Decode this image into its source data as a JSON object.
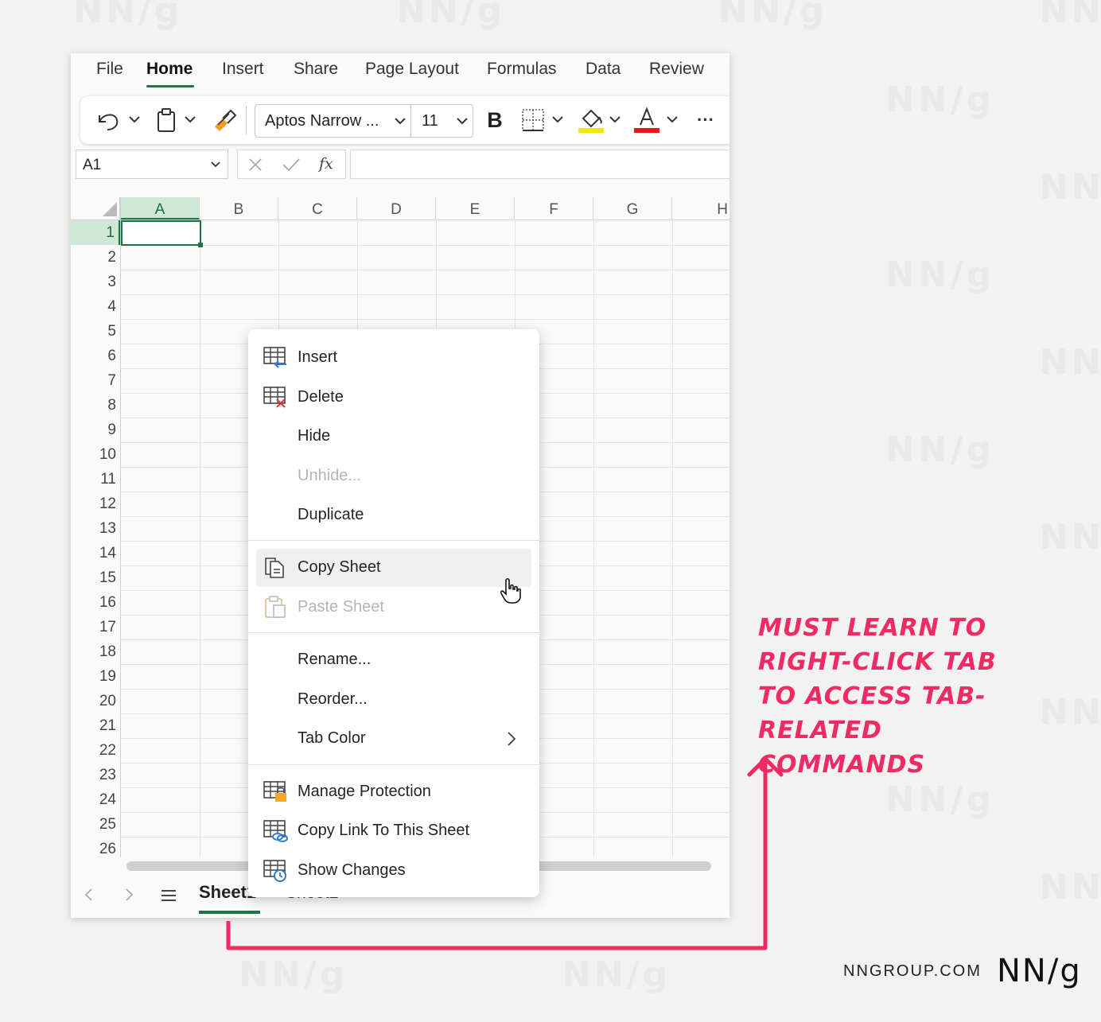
{
  "menu": {
    "file": "File",
    "home": "Home",
    "insert": "Insert",
    "share": "Share",
    "page_layout": "Page Layout",
    "formulas": "Formulas",
    "data": "Data",
    "review": "Review"
  },
  "toolbar": {
    "font_name": "Aptos Narrow ...",
    "font_size": "11",
    "bold": "B",
    "more": "···",
    "highlight_color": "#f5e600",
    "font_color": "#e8141c",
    "icons": [
      "undo-icon",
      "paste-icon",
      "format-painter-icon",
      "borders-icon",
      "fill-color-icon",
      "font-color-icon",
      "more-icon"
    ]
  },
  "name_box": {
    "value": "A1"
  },
  "formula_bar": {
    "fx": "fx"
  },
  "grid": {
    "columns": [
      "A",
      "B",
      "C",
      "D",
      "E",
      "F",
      "G",
      "H"
    ],
    "rows": [
      "1",
      "2",
      "3",
      "4",
      "5",
      "6",
      "7",
      "8",
      "9",
      "10",
      "11",
      "12",
      "13",
      "14",
      "15",
      "16",
      "17",
      "18",
      "19",
      "20",
      "21",
      "22",
      "23",
      "24",
      "25",
      "26"
    ],
    "selected_cell": "A1",
    "accent_color": "#217346"
  },
  "tabs": {
    "sheet1": "Sheet1",
    "sheet2": "Sheet2",
    "add": "+"
  },
  "context_menu": {
    "items": [
      {
        "label": "Insert",
        "icon": "insert-sheet-icon"
      },
      {
        "label": "Delete",
        "icon": "delete-sheet-icon"
      },
      {
        "label": "Hide"
      },
      {
        "label": "Unhide...",
        "disabled": true
      },
      {
        "label": "Duplicate"
      },
      {
        "label": "Copy Sheet",
        "icon": "copy-sheet-icon"
      },
      {
        "label": "Paste Sheet",
        "icon": "paste-sheet-icon",
        "disabled": true
      },
      {
        "label": "Rename..."
      },
      {
        "label": "Reorder..."
      },
      {
        "label": "Tab Color",
        "icon": "chevron-right-icon"
      },
      {
        "label": "Manage Protection",
        "icon": "protection-icon"
      },
      {
        "label": "Copy Link To This Sheet",
        "icon": "link-icon"
      },
      {
        "label": "Show Changes",
        "icon": "history-icon"
      }
    ]
  },
  "annotation": {
    "text": "MUST LEARN TO RIGHT-CLICK TAB TO ACCESS TAB-RELATED COMMANDS",
    "color": "#f02a63"
  },
  "footer": {
    "url": "NNGROUP.COM",
    "logo": "NN/g"
  },
  "watermark": "NN/g"
}
